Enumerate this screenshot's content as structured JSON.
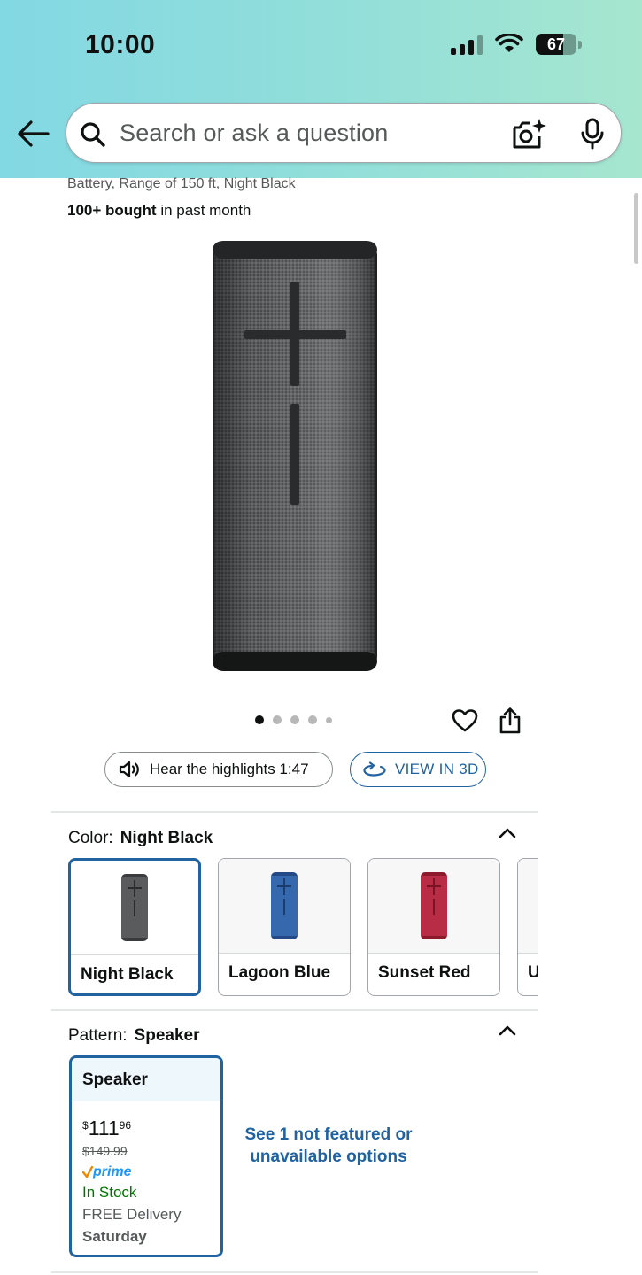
{
  "status_bar": {
    "time": "10:00",
    "battery": "67",
    "battery_level": 0.67
  },
  "search": {
    "placeholder": "Search or ask a question"
  },
  "product": {
    "title_fragment": "Battery, Range of 150 ft, Night Black",
    "bought_bold": "100+ bought",
    "bought_rest": " in past month",
    "image_count": 5,
    "active_image": 0
  },
  "actions": {
    "hear_label": "Hear the highlights 1:47",
    "view3d_label": "VIEW IN 3D"
  },
  "color": {
    "label": "Color:",
    "selected": "Night Black",
    "options": [
      {
        "name": "Night Black",
        "hex": "#3a3b3d"
      },
      {
        "name": "Lagoon Blue",
        "hex": "#2e5ea0"
      },
      {
        "name": "Sunset Red",
        "hex": "#b3243a"
      },
      {
        "name": "U",
        "hex": "#e8e8e8"
      }
    ]
  },
  "pattern": {
    "label": "Pattern:",
    "selected": "Speaker",
    "card": {
      "name": "Speaker",
      "currency": "$",
      "price_whole": "111",
      "price_fraction": "96",
      "list_price": "$149.99",
      "prime": "prime",
      "stock": "In Stock",
      "delivery": "FREE Delivery",
      "delivery_day": "Saturday"
    },
    "see_more": "See 1 not featured or unavailable options"
  },
  "colors": {
    "link": "#2162a1",
    "in_stock": "#007600",
    "prime": "#1a98ff",
    "prime_check": "#f08804"
  }
}
